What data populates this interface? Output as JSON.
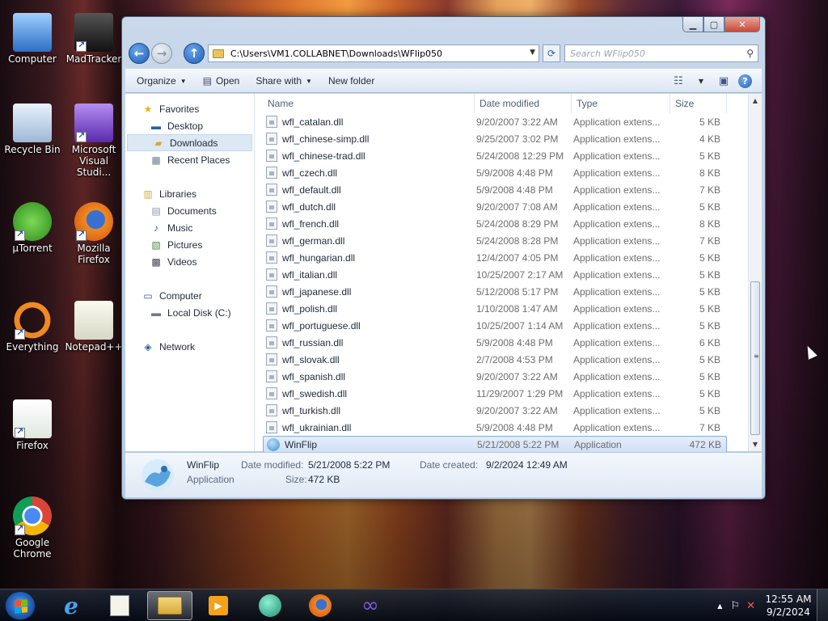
{
  "desktop": {
    "icons": [
      {
        "label": "Computer",
        "icon": "computer-icon"
      },
      {
        "label": "MadTracker",
        "icon": "madtracker-icon"
      },
      {
        "label": "Recycle Bin",
        "icon": "recycle-bin-icon"
      },
      {
        "label": "Microsoft Visual Studi...",
        "icon": "visual-studio-icon"
      },
      {
        "label": "µTorrent",
        "icon": "utorrent-icon"
      },
      {
        "label": "Mozilla Firefox",
        "icon": "firefox-icon"
      },
      {
        "label": "Everything",
        "icon": "everything-icon"
      },
      {
        "label": "Notepad++",
        "icon": "notepadpp-icon"
      },
      {
        "label": "Firefox",
        "icon": "firefox-portable-icon"
      },
      {
        "label": "Google Chrome",
        "icon": "chrome-icon"
      }
    ]
  },
  "window": {
    "address": "C:\\Users\\VM1.COLLABNET\\Downloads\\WFlip050",
    "search_placeholder": "Search WFlip050",
    "toolbar": {
      "organize": "Organize",
      "open": "Open",
      "share_with": "Share with",
      "new_folder": "New folder"
    },
    "nav": {
      "favorites": "Favorites",
      "desktop": "Desktop",
      "downloads": "Downloads",
      "recent_places": "Recent Places",
      "libraries": "Libraries",
      "documents": "Documents",
      "music": "Music",
      "pictures": "Pictures",
      "videos": "Videos",
      "computer": "Computer",
      "local_disk": "Local Disk (C:)",
      "network": "Network"
    },
    "columns": {
      "name": "Name",
      "date": "Date modified",
      "type": "Type",
      "size": "Size"
    },
    "files": [
      {
        "name": "wfl_catalan.dll",
        "date": "9/20/2007 3:22 AM",
        "type": "Application extens...",
        "size": "5 KB"
      },
      {
        "name": "wfl_chinese-simp.dll",
        "date": "9/25/2007 3:02 PM",
        "type": "Application extens...",
        "size": "4 KB"
      },
      {
        "name": "wfl_chinese-trad.dll",
        "date": "5/24/2008 12:29 PM",
        "type": "Application extens...",
        "size": "5 KB"
      },
      {
        "name": "wfl_czech.dll",
        "date": "5/9/2008 4:48 PM",
        "type": "Application extens...",
        "size": "8 KB"
      },
      {
        "name": "wfl_default.dll",
        "date": "5/9/2008 4:48 PM",
        "type": "Application extens...",
        "size": "7 KB"
      },
      {
        "name": "wfl_dutch.dll",
        "date": "9/20/2007 7:08 AM",
        "type": "Application extens...",
        "size": "5 KB"
      },
      {
        "name": "wfl_french.dll",
        "date": "5/24/2008 8:29 PM",
        "type": "Application extens...",
        "size": "8 KB"
      },
      {
        "name": "wfl_german.dll",
        "date": "5/24/2008 8:28 PM",
        "type": "Application extens...",
        "size": "7 KB"
      },
      {
        "name": "wfl_hungarian.dll",
        "date": "12/4/2007 4:05 PM",
        "type": "Application extens...",
        "size": "5 KB"
      },
      {
        "name": "wfl_italian.dll",
        "date": "10/25/2007 2:17 AM",
        "type": "Application extens...",
        "size": "5 KB"
      },
      {
        "name": "wfl_japanese.dll",
        "date": "5/12/2008 5:17 PM",
        "type": "Application extens...",
        "size": "5 KB"
      },
      {
        "name": "wfl_polish.dll",
        "date": "1/10/2008 1:47 AM",
        "type": "Application extens...",
        "size": "5 KB"
      },
      {
        "name": "wfl_portuguese.dll",
        "date": "10/25/2007 1:14 AM",
        "type": "Application extens...",
        "size": "5 KB"
      },
      {
        "name": "wfl_russian.dll",
        "date": "5/9/2008 4:48 PM",
        "type": "Application extens...",
        "size": "6 KB"
      },
      {
        "name": "wfl_slovak.dll",
        "date": "2/7/2008 4:53 PM",
        "type": "Application extens...",
        "size": "5 KB"
      },
      {
        "name": "wfl_spanish.dll",
        "date": "9/20/2007 3:22 AM",
        "type": "Application extens...",
        "size": "5 KB"
      },
      {
        "name": "wfl_swedish.dll",
        "date": "11/29/2007 1:29 PM",
        "type": "Application extens...",
        "size": "5 KB"
      },
      {
        "name": "wfl_turkish.dll",
        "date": "9/20/2007 3:22 AM",
        "type": "Application extens...",
        "size": "5 KB"
      },
      {
        "name": "wfl_ukrainian.dll",
        "date": "5/9/2008 4:48 PM",
        "type": "Application extens...",
        "size": "7 KB"
      },
      {
        "name": "WinFlip",
        "date": "5/21/2008 5:22 PM",
        "type": "Application",
        "size": "472 KB",
        "selected": true
      }
    ],
    "details": {
      "name": "WinFlip",
      "kind": "Application",
      "date_modified_label": "Date modified:",
      "date_modified": "5/21/2008 5:22 PM",
      "date_created_label": "Date created:",
      "date_created": "9/2/2024 12:49 AM",
      "size_label": "Size:",
      "size": "472 KB"
    }
  },
  "taskbar": {
    "time": "12:55 AM",
    "date": "9/2/2024"
  }
}
